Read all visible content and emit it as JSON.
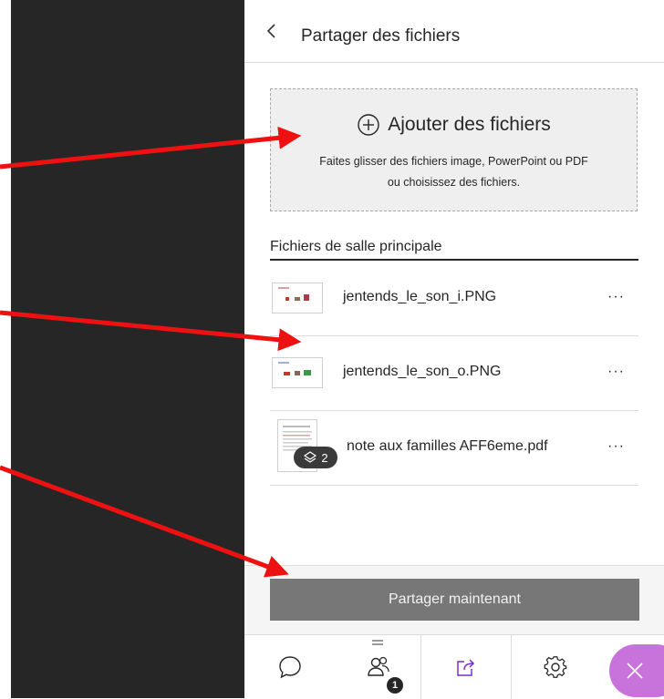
{
  "header": {
    "title": "Partager des fichiers"
  },
  "dropzone": {
    "add_label": "Ajouter des fichiers",
    "hint_line1": "Faites glisser des fichiers image, PowerPoint ou PDF",
    "hint_line2": "ou choisissez des fichiers."
  },
  "files_section": {
    "title": "Fichiers de salle principale",
    "files": [
      {
        "name": "jentends_le_son_i.PNG",
        "more": "···"
      },
      {
        "name": "jentends_le_son_o.PNG",
        "more": "···"
      },
      {
        "name": "note aux familles AFF6eme.pdf",
        "more": "···",
        "page_count": "2"
      }
    ]
  },
  "share_button": {
    "label": "Partager maintenant"
  },
  "bottom_bar": {
    "participants_badge": "1",
    "tabs": [
      "chat",
      "participants",
      "share-content",
      "settings",
      "close"
    ]
  },
  "colors": {
    "dark_panel": "#262626",
    "share_button_bg": "#777777",
    "share_tab_accent": "#7b2fbe",
    "close_fab": "#c873db",
    "annotation_arrow": "#ee1111"
  },
  "icons": {
    "back": "chevron-left-icon",
    "add": "plus-circle-icon",
    "layers": "layers-icon",
    "chat": "chat-bubble-icon",
    "participants": "users-icon",
    "share": "share-arrow-icon",
    "settings": "gear-icon",
    "close": "close-icon",
    "more": "more-horizontal-icon"
  }
}
